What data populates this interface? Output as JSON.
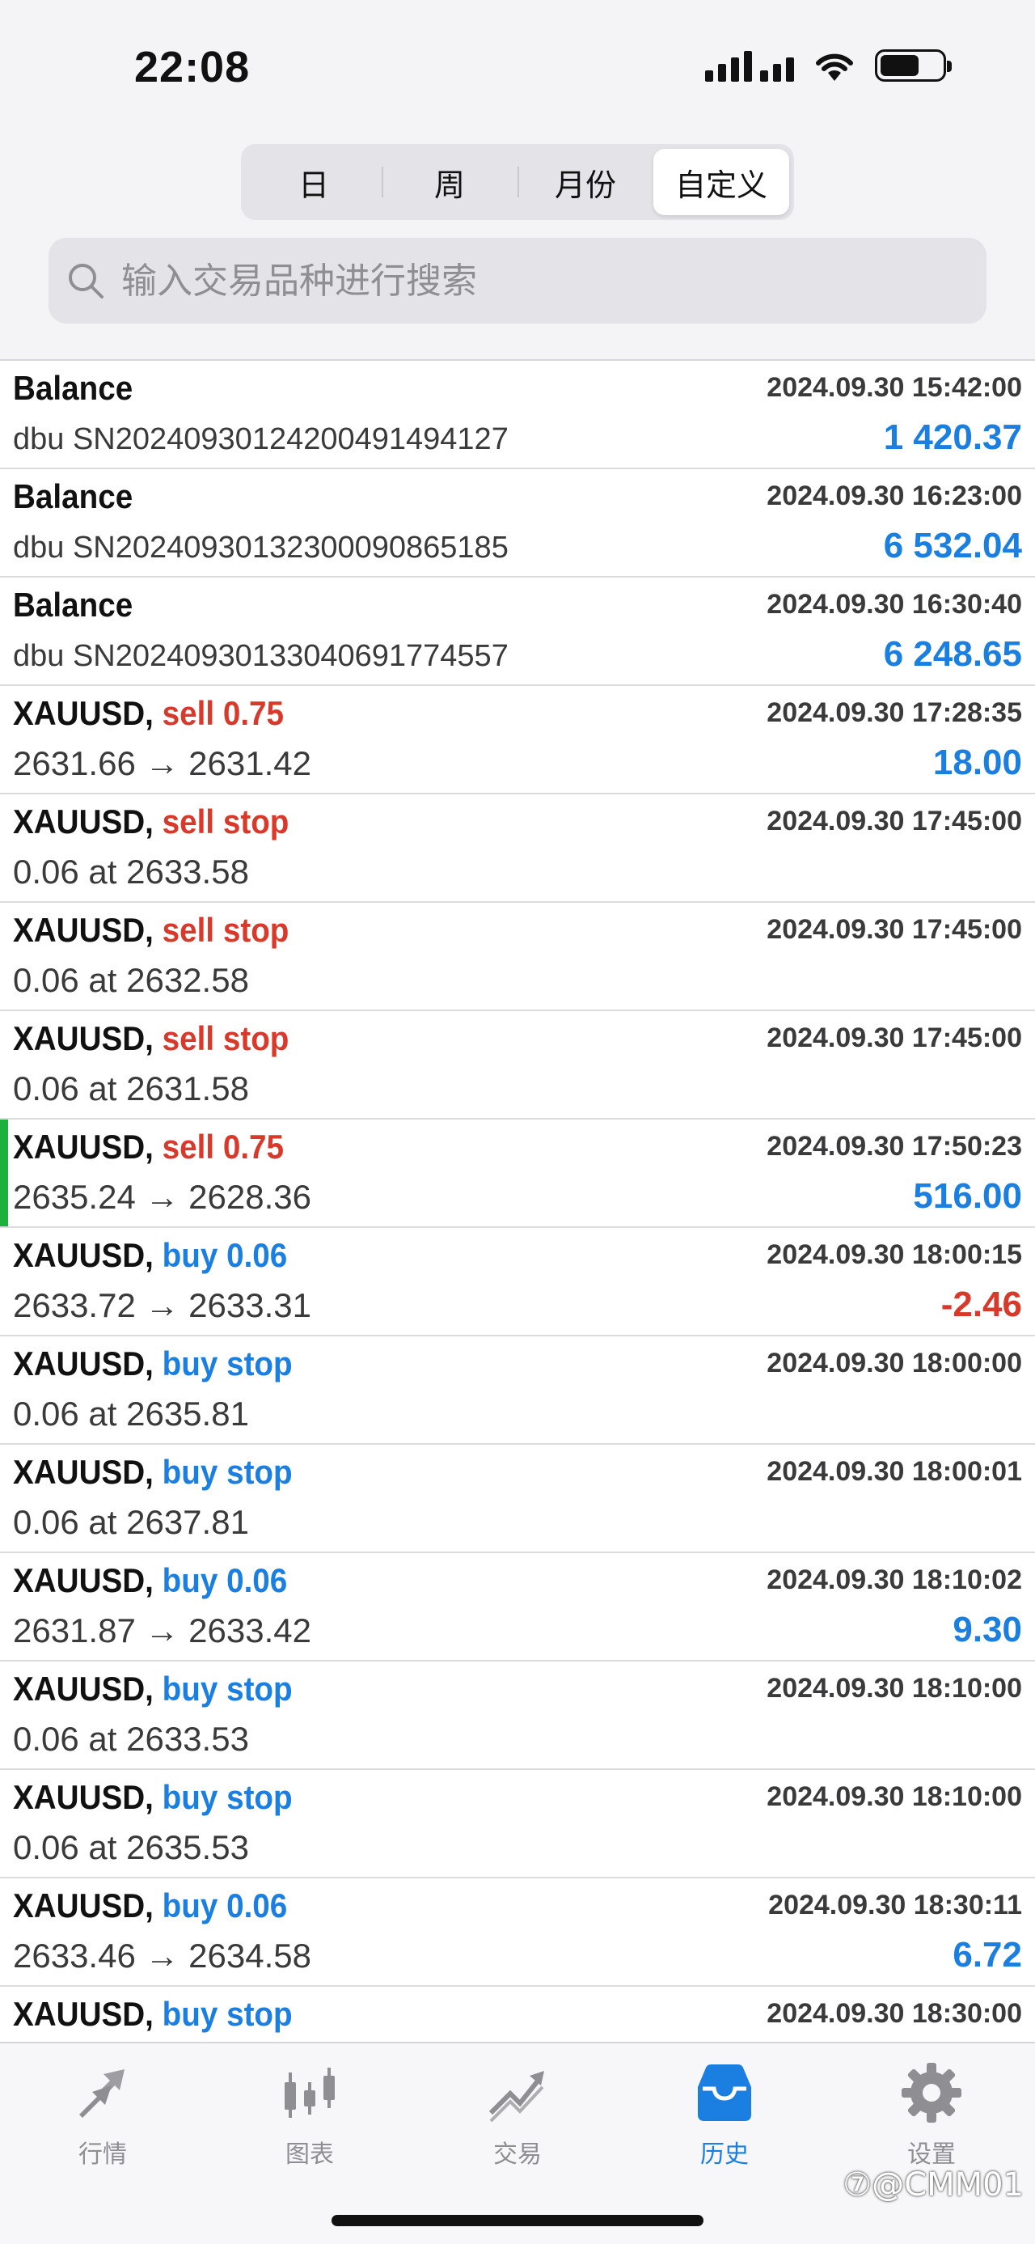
{
  "status": {
    "time": "22:08"
  },
  "segments": [
    {
      "label": "日"
    },
    {
      "label": "周"
    },
    {
      "label": "月份"
    },
    {
      "label": "自定义"
    }
  ],
  "search": {
    "placeholder": "输入交易品种进行搜索"
  },
  "rows": [
    {
      "symbol": "Balance",
      "side": "",
      "side_type": "",
      "date": "2024.09.30 15:42:00",
      "detail": "dbu SN2024093012420049149412​7",
      "amount": "1 420.37",
      "amount_type": "pos"
    },
    {
      "symbol": "Balance",
      "side": "",
      "side_type": "",
      "date": "2024.09.30 16:23:00",
      "detail": "dbu SN20240930132300090865185",
      "amount": "6 532.04",
      "amount_type": "pos"
    },
    {
      "symbol": "Balance",
      "side": "",
      "side_type": "",
      "date": "2024.09.30 16:30:40",
      "detail": "dbu SN20240930133040691774557",
      "amount": "6 248.65",
      "amount_type": "pos"
    },
    {
      "symbol": "XAUUSD,",
      "side": "sell 0.75",
      "side_type": "sell",
      "date": "2024.09.30 17:28:35",
      "detail": "2631.66 → 2631.42",
      "amount": "18.00",
      "amount_type": "pos"
    },
    {
      "symbol": "XAUUSD,",
      "side": "sell stop",
      "side_type": "sell",
      "date": "2024.09.30 17:45:00",
      "detail": "0.06 at 2633.58",
      "amount": "",
      "amount_type": ""
    },
    {
      "symbol": "XAUUSD,",
      "side": "sell stop",
      "side_type": "sell",
      "date": "2024.09.30 17:45:00",
      "detail": "0.06 at 2632.58",
      "amount": "",
      "amount_type": ""
    },
    {
      "symbol": "XAUUSD,",
      "side": "sell stop",
      "side_type": "sell",
      "date": "2024.09.30 17:45:00",
      "detail": "0.06 at 2631.58",
      "amount": "",
      "amount_type": ""
    },
    {
      "symbol": "XAUUSD,",
      "side": "sell 0.75",
      "side_type": "sell",
      "date": "2024.09.30 17:50:23",
      "detail": "2635.24 → 2628.36",
      "amount": "516.00",
      "amount_type": "pos",
      "active": true
    },
    {
      "symbol": "XAUUSD,",
      "side": "buy 0.06",
      "side_type": "buy",
      "date": "2024.09.30 18:00:15",
      "detail": "2633.72 → 2633.31",
      "amount": "-2.46",
      "amount_type": "neg"
    },
    {
      "symbol": "XAUUSD,",
      "side": "buy stop",
      "side_type": "buy",
      "date": "2024.09.30 18:00:00",
      "detail": "0.06 at 2635.81",
      "amount": "",
      "amount_type": ""
    },
    {
      "symbol": "XAUUSD,",
      "side": "buy stop",
      "side_type": "buy",
      "date": "2024.09.30 18:00:01",
      "detail": "0.06 at 2637.81",
      "amount": "",
      "amount_type": ""
    },
    {
      "symbol": "XAUUSD,",
      "side": "buy 0.06",
      "side_type": "buy",
      "date": "2024.09.30 18:10:02",
      "detail": "2631.87 → 2633.42",
      "amount": "9.30",
      "amount_type": "pos"
    },
    {
      "symbol": "XAUUSD,",
      "side": "buy stop",
      "side_type": "buy",
      "date": "2024.09.30 18:10:00",
      "detail": "0.06 at 2633.53",
      "amount": "",
      "amount_type": ""
    },
    {
      "symbol": "XAUUSD,",
      "side": "buy stop",
      "side_type": "buy",
      "date": "2024.09.30 18:10:00",
      "detail": "0.06 at 2635.53",
      "amount": "",
      "amount_type": ""
    },
    {
      "symbol": "XAUUSD,",
      "side": "buy 0.06",
      "side_type": "buy",
      "date": "2024.09.30 18:30:11",
      "detail": "2633.46 → 2634.58",
      "amount": "6.72",
      "amount_type": "pos"
    },
    {
      "symbol": "XAUUSD,",
      "side": "buy stop",
      "side_type": "buy",
      "date": "2024.09.30 18:30:00",
      "detail": "",
      "amount": "",
      "amount_type": ""
    }
  ],
  "tabs": [
    {
      "label": "行情",
      "icon": "quotes-icon"
    },
    {
      "label": "图表",
      "icon": "chart-icon"
    },
    {
      "label": "交易",
      "icon": "trade-icon"
    },
    {
      "label": "历史",
      "icon": "history-icon",
      "active": true
    },
    {
      "label": "设置",
      "icon": "settings-icon"
    }
  ],
  "watermark": "⑦@CMM01",
  "colors": {
    "accent": "#1a7fe0",
    "sell": "#d8392b",
    "active_marker": "#1bb13a"
  }
}
